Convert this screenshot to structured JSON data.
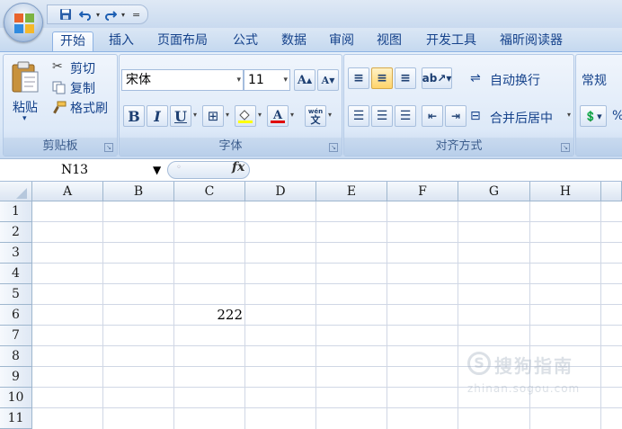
{
  "title_bar": {
    "quick_access": [
      "save-icon",
      "undo-icon",
      "redo-icon"
    ],
    "customize_glyph": "="
  },
  "tabs": [
    {
      "label": "开始",
      "active": true
    },
    {
      "label": "插入",
      "active": false
    },
    {
      "label": "页面布局",
      "active": false
    },
    {
      "label": "公式",
      "active": false
    },
    {
      "label": "数据",
      "active": false
    },
    {
      "label": "审阅",
      "active": false
    },
    {
      "label": "视图",
      "active": false
    },
    {
      "label": "开发工具",
      "active": false
    },
    {
      "label": "福昕阅读器",
      "active": false
    }
  ],
  "ribbon": {
    "clipboard": {
      "group_label": "剪贴板",
      "paste_label": "粘贴",
      "cut_label": "剪切",
      "copy_label": "复制",
      "format_painter_label": "格式刷"
    },
    "font": {
      "group_label": "字体",
      "font_name": "宋体",
      "font_size": "11",
      "bold": "B",
      "italic": "I",
      "underline": "U",
      "grow": "A",
      "shrink": "A",
      "phonetic": "wén"
    },
    "alignment": {
      "group_label": "对齐方式",
      "wrap_text_label": "自动换行",
      "merge_center_label": "合并后居中"
    },
    "number": {
      "format": "常规",
      "percent": "%"
    }
  },
  "formula_bar": {
    "name_box": "N13",
    "fx_label": "fx",
    "formula": ""
  },
  "sheet": {
    "columns": [
      "A",
      "B",
      "C",
      "D",
      "E",
      "F",
      "G",
      "H"
    ],
    "rows": [
      "1",
      "2",
      "3",
      "4",
      "5",
      "6",
      "7",
      "8",
      "9",
      "10",
      "11"
    ],
    "cells": {
      "C6": "222"
    }
  },
  "watermark": {
    "text": "搜狗指南",
    "url": "zhinan.sogou.com"
  },
  "colors": {
    "ribbon_bg": "#dbe8f7",
    "tab_text": "#15428b",
    "grid_line": "#d0d7e5",
    "header_bg": "#dbe5f2"
  }
}
